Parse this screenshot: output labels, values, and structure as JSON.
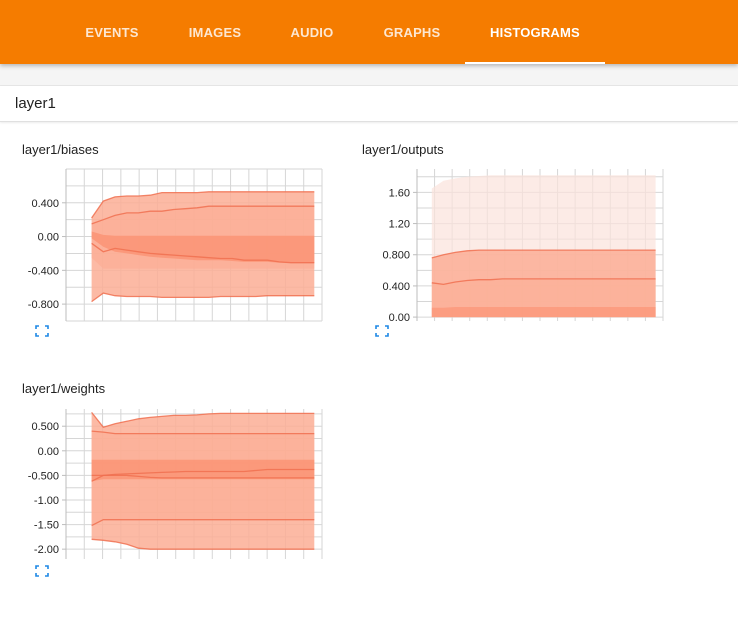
{
  "nav": {
    "tabs": [
      {
        "label": "EVENTS"
      },
      {
        "label": "IMAGES"
      },
      {
        "label": "AUDIO"
      },
      {
        "label": "GRAPHS"
      },
      {
        "label": "HISTOGRAMS",
        "active": true
      }
    ]
  },
  "colors": {
    "header": "#f57c00",
    "band_outer": "#fbe3db",
    "band_mid": "#fcae95",
    "band_inner": "#fb9070",
    "line": "#f07050"
  },
  "card": {
    "title": "layer1"
  },
  "expand_icon": "expand-icon",
  "chart_data": [
    {
      "type": "area",
      "title": "layer1/biases",
      "ylim": [
        -1.0,
        0.8
      ],
      "yticks": [
        0.4,
        0.0,
        -0.4,
        -0.8
      ],
      "ytick_labels": [
        "0.400",
        "0.00",
        "-0.400",
        "-0.800"
      ],
      "x": [
        0,
        1,
        2,
        3,
        4,
        5,
        6,
        7,
        8,
        9,
        10,
        11,
        12,
        13,
        14,
        15,
        16,
        17,
        18,
        19
      ],
      "bands": [
        {
          "lower": [
            -0.77,
            -0.67,
            -0.7,
            -0.71,
            -0.71,
            -0.71,
            -0.72,
            -0.72,
            -0.72,
            -0.72,
            -0.72,
            -0.71,
            -0.71,
            -0.71,
            -0.71,
            -0.7,
            -0.7,
            -0.7,
            -0.7,
            -0.7
          ],
          "upper": [
            0.22,
            0.42,
            0.47,
            0.48,
            0.48,
            0.49,
            0.52,
            0.52,
            0.52,
            0.52,
            0.53,
            0.53,
            0.53,
            0.53,
            0.53,
            0.53,
            0.53,
            0.53,
            0.53,
            0.53
          ]
        },
        {
          "lower": [
            -0.25,
            -0.38,
            -0.38,
            -0.38,
            -0.38,
            -0.38,
            -0.38,
            -0.38,
            -0.38,
            -0.38,
            -0.38,
            -0.38,
            -0.38,
            -0.38,
            -0.38,
            -0.38,
            -0.38,
            -0.38,
            -0.38,
            -0.38
          ],
          "upper": [
            0.15,
            0.2,
            0.25,
            0.28,
            0.28,
            0.3,
            0.3,
            0.32,
            0.33,
            0.34,
            0.36,
            0.36,
            0.36,
            0.36,
            0.36,
            0.36,
            0.36,
            0.36,
            0.36,
            0.36
          ]
        },
        {
          "lower": [
            -0.02,
            -0.12,
            -0.18,
            -0.2,
            -0.22,
            -0.24,
            -0.25,
            -0.26,
            -0.27,
            -0.28,
            -0.28,
            -0.28,
            -0.29,
            -0.3,
            -0.3,
            -0.3,
            -0.31,
            -0.31,
            -0.31,
            -0.31
          ],
          "upper": [
            0.06,
            0.02,
            0.01,
            0.01,
            0.01,
            0.01,
            0.01,
            0.01,
            0.01,
            0.01,
            0.01,
            0.01,
            0.01,
            0.01,
            0.01,
            0.01,
            0.01,
            0.01,
            0.01,
            0.01
          ]
        }
      ],
      "lines": [
        [
          0.22,
          0.42,
          0.47,
          0.48,
          0.48,
          0.49,
          0.52,
          0.52,
          0.52,
          0.52,
          0.53,
          0.53,
          0.53,
          0.53,
          0.53,
          0.53,
          0.53,
          0.53,
          0.53,
          0.53
        ],
        [
          0.15,
          0.2,
          0.25,
          0.28,
          0.28,
          0.3,
          0.3,
          0.32,
          0.33,
          0.34,
          0.36,
          0.36,
          0.36,
          0.36,
          0.36,
          0.36,
          0.36,
          0.36,
          0.36,
          0.36
        ],
        [
          -0.08,
          -0.18,
          -0.14,
          -0.16,
          -0.18,
          -0.2,
          -0.21,
          -0.22,
          -0.23,
          -0.24,
          -0.25,
          -0.26,
          -0.26,
          -0.28,
          -0.28,
          -0.28,
          -0.3,
          -0.31,
          -0.31,
          -0.31
        ],
        [
          -0.77,
          -0.67,
          -0.7,
          -0.71,
          -0.71,
          -0.71,
          -0.72,
          -0.72,
          -0.72,
          -0.72,
          -0.72,
          -0.71,
          -0.71,
          -0.71,
          -0.71,
          -0.7,
          -0.7,
          -0.7,
          -0.7,
          -0.7
        ]
      ]
    },
    {
      "type": "area",
      "title": "layer1/outputs",
      "ylim": [
        -0.05,
        1.9
      ],
      "yticks": [
        1.6,
        1.2,
        0.8,
        0.4,
        0.0
      ],
      "ytick_labels": [
        "1.60",
        "1.20",
        "0.800",
        "0.400",
        "0.00"
      ],
      "x": [
        0,
        1,
        2,
        3,
        4,
        5,
        6,
        7,
        8,
        9,
        10,
        11,
        12,
        13,
        14,
        15,
        16,
        17,
        18,
        19
      ],
      "bands": [
        {
          "lower": [
            0,
            0,
            0,
            0,
            0,
            0,
            0,
            0,
            0,
            0,
            0,
            0,
            0,
            0,
            0,
            0,
            0,
            0,
            0,
            0
          ],
          "upper": [
            1.65,
            1.75,
            1.78,
            1.8,
            1.81,
            1.82,
            1.82,
            1.82,
            1.82,
            1.82,
            1.82,
            1.82,
            1.82,
            1.82,
            1.82,
            1.82,
            1.82,
            1.82,
            1.82,
            1.82
          ]
        },
        {
          "lower": [
            0,
            0,
            0,
            0,
            0,
            0,
            0,
            0,
            0,
            0,
            0,
            0,
            0,
            0,
            0,
            0,
            0,
            0,
            0,
            0
          ],
          "upper": [
            0.76,
            0.8,
            0.83,
            0.85,
            0.86,
            0.86,
            0.86,
            0.86,
            0.86,
            0.86,
            0.86,
            0.86,
            0.86,
            0.86,
            0.86,
            0.86,
            0.86,
            0.86,
            0.86,
            0.86
          ]
        },
        {
          "lower": [
            0,
            0,
            0,
            0,
            0,
            0,
            0,
            0,
            0,
            0,
            0,
            0,
            0,
            0,
            0,
            0,
            0,
            0,
            0,
            0
          ],
          "upper": [
            0.44,
            0.42,
            0.45,
            0.47,
            0.48,
            0.48,
            0.49,
            0.49,
            0.49,
            0.49,
            0.49,
            0.49,
            0.49,
            0.49,
            0.49,
            0.49,
            0.49,
            0.49,
            0.49,
            0.49
          ]
        },
        {
          "lower": [
            0,
            0,
            0,
            0,
            0,
            0,
            0,
            0,
            0,
            0,
            0,
            0,
            0,
            0,
            0,
            0,
            0,
            0,
            0,
            0
          ],
          "upper": [
            0.12,
            0.12,
            0.13,
            0.13,
            0.13,
            0.13,
            0.13,
            0.13,
            0.13,
            0.13,
            0.13,
            0.13,
            0.13,
            0.13,
            0.13,
            0.13,
            0.13,
            0.13,
            0.13,
            0.13
          ]
        }
      ],
      "lines": [
        [
          0.44,
          0.42,
          0.45,
          0.47,
          0.48,
          0.48,
          0.49,
          0.49,
          0.49,
          0.49,
          0.49,
          0.49,
          0.49,
          0.49,
          0.49,
          0.49,
          0.49,
          0.49,
          0.49,
          0.49
        ],
        [
          0.76,
          0.8,
          0.83,
          0.85,
          0.86,
          0.86,
          0.86,
          0.86,
          0.86,
          0.86,
          0.86,
          0.86,
          0.86,
          0.86,
          0.86,
          0.86,
          0.86,
          0.86,
          0.86,
          0.86
        ]
      ]
    },
    {
      "type": "area",
      "title": "layer1/weights",
      "ylim": [
        -2.2,
        0.85
      ],
      "yticks": [
        0.5,
        0.0,
        -0.5,
        -1.0,
        -1.5,
        -2.0
      ],
      "ytick_labels": [
        "0.500",
        "0.00",
        "-0.500",
        "-1.00",
        "-1.50",
        "-2.00"
      ],
      "x": [
        0,
        1,
        2,
        3,
        4,
        5,
        6,
        7,
        8,
        9,
        10,
        11,
        12,
        13,
        14,
        15,
        16,
        17,
        18,
        19
      ],
      "bands": [
        {
          "lower": [
            -1.8,
            -1.82,
            -1.85,
            -1.9,
            -1.98,
            -2.0,
            -2.0,
            -2.0,
            -2.0,
            -2.0,
            -2.0,
            -2.0,
            -2.0,
            -2.0,
            -2.0,
            -2.0,
            -2.0,
            -2.0,
            -2.0,
            -2.0
          ],
          "upper": [
            0.78,
            0.48,
            0.55,
            0.6,
            0.65,
            0.68,
            0.7,
            0.72,
            0.72,
            0.73,
            0.75,
            0.76,
            0.76,
            0.76,
            0.76,
            0.76,
            0.76,
            0.76,
            0.76,
            0.76
          ]
        },
        {
          "lower": [
            -1.52,
            -1.4,
            -1.4,
            -1.4,
            -1.4,
            -1.4,
            -1.4,
            -1.4,
            -1.4,
            -1.4,
            -1.4,
            -1.4,
            -1.4,
            -1.4,
            -1.4,
            -1.4,
            -1.4,
            -1.4,
            -1.4,
            -1.4
          ],
          "upper": [
            0.4,
            0.38,
            0.35,
            0.35,
            0.35,
            0.35,
            0.35,
            0.35,
            0.35,
            0.35,
            0.35,
            0.35,
            0.35,
            0.35,
            0.35,
            0.35,
            0.35,
            0.35,
            0.35,
            0.35
          ]
        },
        {
          "lower": [
            -0.62,
            -0.58,
            -0.58,
            -0.58,
            -0.58,
            -0.58,
            -0.58,
            -0.58,
            -0.58,
            -0.58,
            -0.58,
            -0.58,
            -0.58,
            -0.58,
            -0.58,
            -0.58,
            -0.58,
            -0.58,
            -0.58,
            -0.58
          ],
          "upper": [
            -0.18,
            -0.18,
            -0.18,
            -0.18,
            -0.18,
            -0.18,
            -0.18,
            -0.18,
            -0.18,
            -0.18,
            -0.18,
            -0.18,
            -0.18,
            -0.18,
            -0.18,
            -0.18,
            -0.18,
            -0.18,
            -0.18,
            -0.18
          ]
        }
      ],
      "lines": [
        [
          0.78,
          0.48,
          0.55,
          0.6,
          0.65,
          0.68,
          0.7,
          0.72,
          0.72,
          0.73,
          0.75,
          0.76,
          0.76,
          0.76,
          0.76,
          0.76,
          0.76,
          0.76,
          0.76,
          0.76
        ],
        [
          0.4,
          0.38,
          0.35,
          0.35,
          0.35,
          0.35,
          0.35,
          0.35,
          0.35,
          0.35,
          0.35,
          0.35,
          0.35,
          0.35,
          0.35,
          0.35,
          0.35,
          0.35,
          0.35,
          0.35
        ],
        [
          -0.62,
          -0.5,
          -0.48,
          -0.47,
          -0.46,
          -0.45,
          -0.44,
          -0.43,
          -0.42,
          -0.42,
          -0.42,
          -0.42,
          -0.42,
          -0.42,
          -0.4,
          -0.38,
          -0.38,
          -0.38,
          -0.38,
          -0.38
        ],
        [
          -0.5,
          -0.5,
          -0.5,
          -0.5,
          -0.52,
          -0.54,
          -0.55,
          -0.55,
          -0.55,
          -0.55,
          -0.55,
          -0.55,
          -0.55,
          -0.55,
          -0.55,
          -0.55,
          -0.55,
          -0.55,
          -0.55,
          -0.55
        ],
        [
          -1.52,
          -1.4,
          -1.4,
          -1.4,
          -1.4,
          -1.4,
          -1.4,
          -1.4,
          -1.4,
          -1.4,
          -1.4,
          -1.4,
          -1.4,
          -1.4,
          -1.4,
          -1.4,
          -1.4,
          -1.4,
          -1.4,
          -1.4
        ],
        [
          -1.8,
          -1.82,
          -1.85,
          -1.9,
          -1.98,
          -2.0,
          -2.0,
          -2.0,
          -2.0,
          -2.0,
          -2.0,
          -2.0,
          -2.0,
          -2.0,
          -2.0,
          -2.0,
          -2.0,
          -2.0,
          -2.0,
          -2.0
        ]
      ]
    }
  ]
}
